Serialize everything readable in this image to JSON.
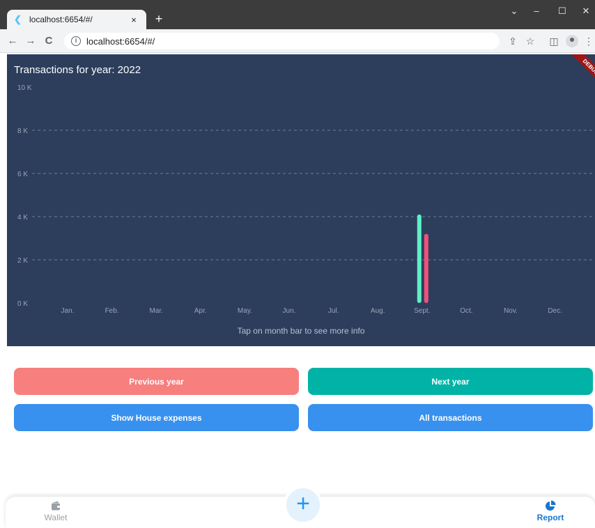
{
  "browser": {
    "tab_title": "localhost:6654/#/",
    "tab_close": "×",
    "new_tab": "+",
    "url": "localhost:6654/#/",
    "back": "←",
    "forward": "→",
    "reload": "C",
    "minimize": "–",
    "maximize": "☐",
    "close": "✕",
    "dropdown": "⌄",
    "share": "⇪",
    "star": "☆",
    "sidepanel": "◫",
    "menu": "⋮"
  },
  "debug_banner": "DEBUG",
  "chart": {
    "title": "Transactions for year: 2022",
    "hint": "Tap on month bar to see more info",
    "background": "#2c3e5c",
    "income_color": "#5ef0c6",
    "expense_color": "#f0507a"
  },
  "chart_data": {
    "type": "bar",
    "title": "Transactions for year: 2022",
    "categories": [
      "Jan.",
      "Feb.",
      "Mar.",
      "Apr.",
      "May.",
      "Jun.",
      "Jul.",
      "Aug.",
      "Sept.",
      "Oct.",
      "Nov.",
      "Dec."
    ],
    "y_ticks": [
      "0 K",
      "2 K",
      "4 K",
      "6 K",
      "8 K",
      "10 K"
    ],
    "ylim": [
      0,
      10000
    ],
    "grid": true,
    "series": [
      {
        "color": "#5ef0c6",
        "values": [
          0,
          0,
          0,
          0,
          0,
          0,
          0,
          0,
          4100,
          0,
          0,
          0
        ]
      },
      {
        "color": "#f0507a",
        "values": [
          0,
          0,
          0,
          0,
          0,
          0,
          0,
          0,
          3200,
          0,
          0,
          0
        ]
      }
    ]
  },
  "buttons": {
    "previous_year": "Previous year",
    "next_year": "Next year",
    "house_expenses": "Show House expenses",
    "all_transactions": "All transactions",
    "previous_color": "#f77f7e",
    "next_color": "#00b3a6",
    "blue_color": "#3891ee"
  },
  "bottom_nav": {
    "wallet": "Wallet",
    "report": "Report",
    "fab": "+",
    "inactive_color": "#9aa0a6",
    "active_color": "#1976d2"
  }
}
